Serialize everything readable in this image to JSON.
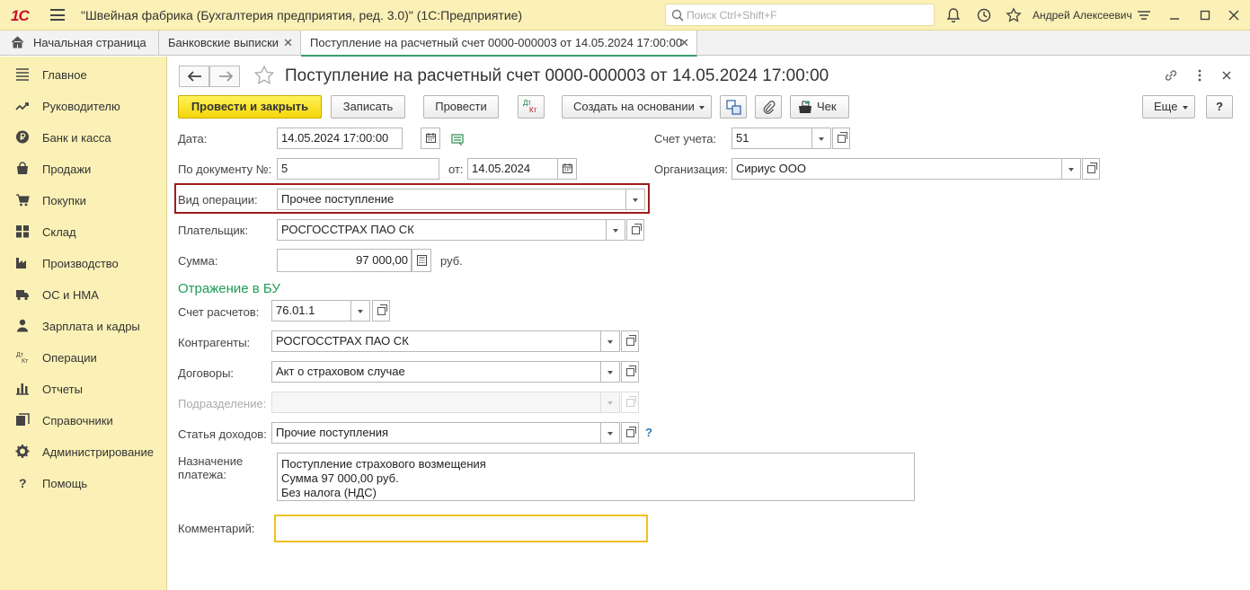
{
  "app": {
    "logo": "1С",
    "title": "\"Швейная фабрика (Бухгалтерия предприятия, ред. 3.0)\"  (1С:Предприятие)",
    "search_placeholder": "Поиск Ctrl+Shift+F",
    "user": "Андрей Алексеевич"
  },
  "tabs": [
    {
      "label": "Начальная страница"
    },
    {
      "label": "Банковские выписки"
    },
    {
      "label": "Поступление на расчетный счет 0000-000003 от 14.05.2024 17:00:00"
    }
  ],
  "sidebar": {
    "items": [
      {
        "label": "Главное",
        "icon": "list-icon"
      },
      {
        "label": "Руководителю",
        "icon": "trend-icon"
      },
      {
        "label": "Банк и касса",
        "icon": "ruble-icon"
      },
      {
        "label": "Продажи",
        "icon": "bag-icon"
      },
      {
        "label": "Покупки",
        "icon": "cart-icon"
      },
      {
        "label": "Склад",
        "icon": "warehouse-icon"
      },
      {
        "label": "Производство",
        "icon": "factory-icon"
      },
      {
        "label": "ОС и НМА",
        "icon": "truck-icon"
      },
      {
        "label": "Зарплата и кадры",
        "icon": "person-icon"
      },
      {
        "label": "Операции",
        "icon": "dt-kt-icon"
      },
      {
        "label": "Отчеты",
        "icon": "bar-chart-icon"
      },
      {
        "label": "Справочники",
        "icon": "books-icon"
      },
      {
        "label": "Администрирование",
        "icon": "gear-icon"
      },
      {
        "label": "Помощь",
        "icon": "question-icon"
      }
    ]
  },
  "document": {
    "title": "Поступление на расчетный счет 0000-000003 от 14.05.2024 17:00:00"
  },
  "toolbar": {
    "post_close": "Провести и закрыть",
    "save": "Записать",
    "post": "Провести",
    "dt": "Дт",
    "kt": "Кт",
    "create_based": "Создать на основании",
    "check": "Чек",
    "more": "Еще",
    "help": "?"
  },
  "form": {
    "date_label": "Дата:",
    "date_value": "14.05.2024 17:00:00",
    "account_label": "Счет учета:",
    "account_value": "51",
    "docnum_label": "По документу №:",
    "docnum_value": "5",
    "from_label": "от:",
    "from_value": "14.05.2024",
    "org_label": "Организация:",
    "org_value": "Сириус ООО",
    "optype_label": "Вид операции:",
    "optype_value": "Прочее поступление",
    "payer_label": "Плательщик:",
    "payer_value": "РОСГОССТРАХ ПАО СК",
    "sum_label": "Сумма:",
    "sum_value": "97 000,00",
    "currency": "руб.",
    "section_title": "Отражение в БУ",
    "settle_label": "Счет расчетов:",
    "settle_value": "76.01.1",
    "contractors_label": "Контрагенты:",
    "contractors_value": "РОСГОССТРАХ ПАО СК",
    "contracts_label": "Договоры:",
    "contracts_value": "Акт о страховом случае",
    "dept_label": "Подразделение:",
    "dept_value": "",
    "income_label": "Статья доходов:",
    "income_value": "Прочие поступления",
    "income_help": "?",
    "purpose_label_1": "Назначение",
    "purpose_label_2": "платежа:",
    "purpose_lines": [
      "Поступление страхового возмещения",
      "Сумма 97 000,00 руб.",
      "Без налога (НДС)"
    ],
    "comment_label": "Комментарий:",
    "comment_value": ""
  },
  "colors": {
    "titlebar": "#fbf1b6",
    "sidebar": "#fbf1b6",
    "primary_button": "#f5d60a",
    "section_green": "#1e9c55",
    "highlight_red": "#9e1c1c",
    "comment_border": "#f0c020"
  }
}
